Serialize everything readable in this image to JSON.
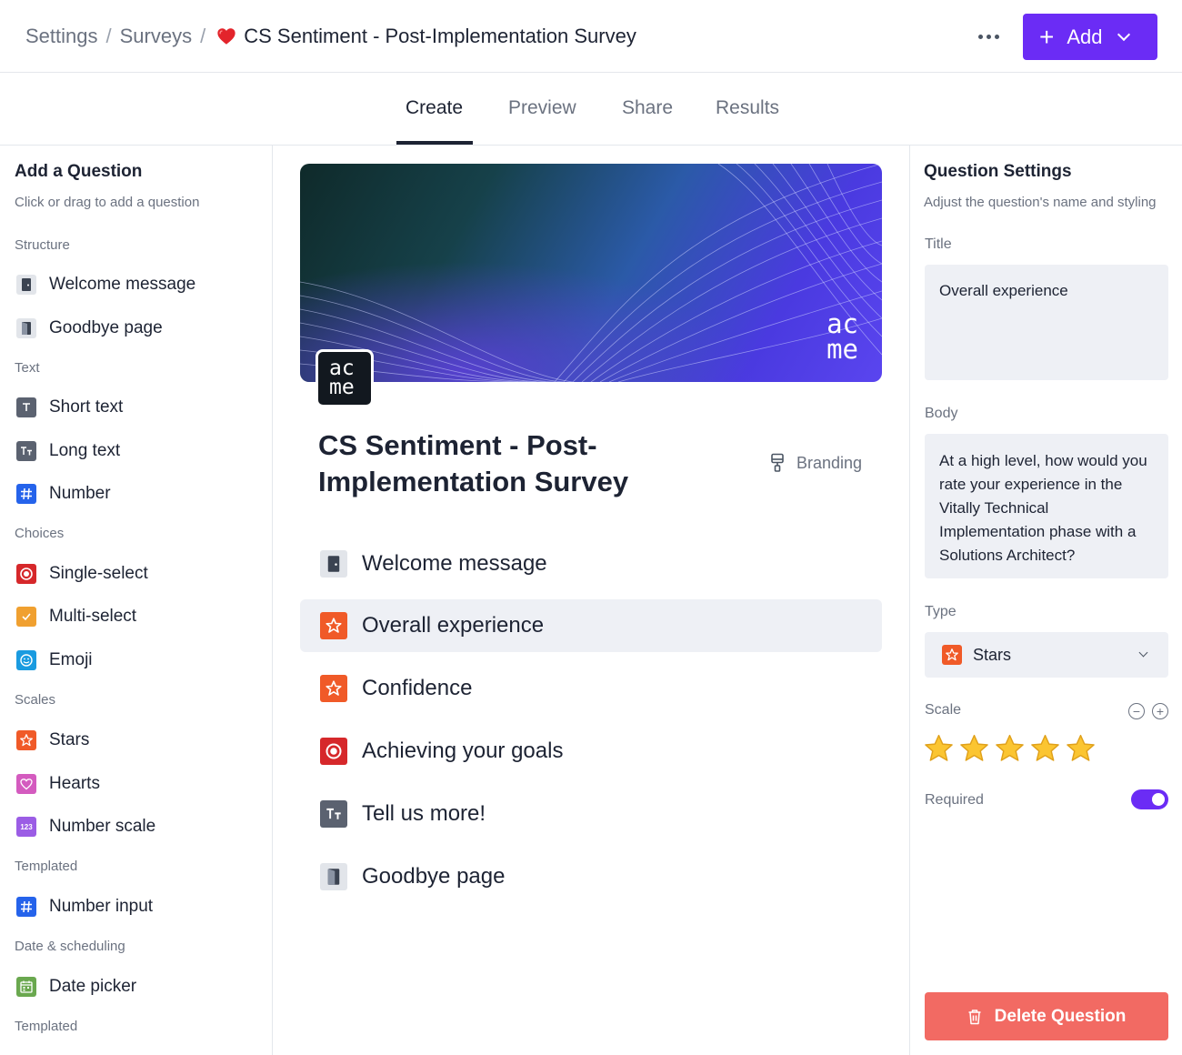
{
  "header": {
    "breadcrumb": [
      "Settings",
      "Surveys",
      "CS Sentiment - Post-Implementation Survey"
    ],
    "breadcrumb_separator": "/",
    "add_label": "Add"
  },
  "tabs": [
    {
      "label": "Create",
      "active": true
    },
    {
      "label": "Preview",
      "active": false
    },
    {
      "label": "Share",
      "active": false
    },
    {
      "label": "Results",
      "active": false
    }
  ],
  "left_panel": {
    "title": "Add a Question",
    "subtitle": "Click or drag to add a question",
    "sections": [
      {
        "label": "Structure",
        "items": [
          {
            "label": "Welcome message",
            "icon": "door-icon"
          },
          {
            "label": "Goodbye page",
            "icon": "exit-icon"
          }
        ]
      },
      {
        "label": "Text",
        "items": [
          {
            "label": "Short text",
            "icon": "short-text-icon"
          },
          {
            "label": "Long text",
            "icon": "long-text-icon"
          },
          {
            "label": "Number",
            "icon": "hash-icon"
          }
        ]
      },
      {
        "label": "Choices",
        "items": [
          {
            "label": "Single-select",
            "icon": "radio-icon"
          },
          {
            "label": "Multi-select",
            "icon": "checkbox-icon"
          },
          {
            "label": "Emoji",
            "icon": "smiley-icon"
          }
        ]
      },
      {
        "label": "Scales",
        "items": [
          {
            "label": "Stars",
            "icon": "star-icon"
          },
          {
            "label": "Hearts",
            "icon": "heart-icon"
          },
          {
            "label": "Number scale",
            "icon": "number-scale-icon",
            "glyph": "123"
          }
        ]
      },
      {
        "label": "Templated",
        "items": [
          {
            "label": "Number input",
            "icon": "hash-icon"
          }
        ]
      },
      {
        "label": "Date & scheduling",
        "items": [
          {
            "label": "Date picker",
            "icon": "calendar-icon"
          }
        ]
      },
      {
        "label": "Templated",
        "items": []
      }
    ]
  },
  "survey": {
    "banner_watermark": [
      "ac",
      "me"
    ],
    "logo_text": [
      "ac",
      "me"
    ],
    "title": "CS Sentiment - Post-Implementation Survey",
    "branding_label": "Branding",
    "questions": [
      {
        "label": "Welcome message",
        "icon": "door-icon",
        "selected": false
      },
      {
        "label": "Overall experience",
        "icon": "star-icon",
        "selected": true
      },
      {
        "label": "Confidence",
        "icon": "star-icon",
        "selected": false
      },
      {
        "label": "Achieving your goals",
        "icon": "radio-icon",
        "selected": false
      },
      {
        "label": "Tell us more!",
        "icon": "long-text-icon",
        "selected": false
      },
      {
        "label": "Goodbye page",
        "icon": "exit-icon",
        "selected": false
      }
    ]
  },
  "settings": {
    "title": "Question Settings",
    "subtitle": "Adjust the question's name and styling",
    "title_label": "Title",
    "title_value": "Overall experience",
    "body_label": "Body",
    "body_value": "At a high level, how would you rate your experience in the Vitally Technical Implementation phase with a Solutions Architect?",
    "type_label": "Type",
    "type_value": "Stars",
    "scale_label": "Scale",
    "scale_value": 5,
    "required_label": "Required",
    "required": true,
    "delete_label": "Delete Question"
  },
  "colors": {
    "accent": "#6b2cf5",
    "danger": "#f26a63",
    "star": "#f05a28",
    "radio": "#d6282b",
    "checkbox": "#f0a030",
    "emoji": "#1a9be0",
    "heart": "#d45bbf",
    "number_scale": "#9b5de5",
    "hash": "#2563eb",
    "calendar": "#6aa84f",
    "text_icon": "#5b6270"
  }
}
